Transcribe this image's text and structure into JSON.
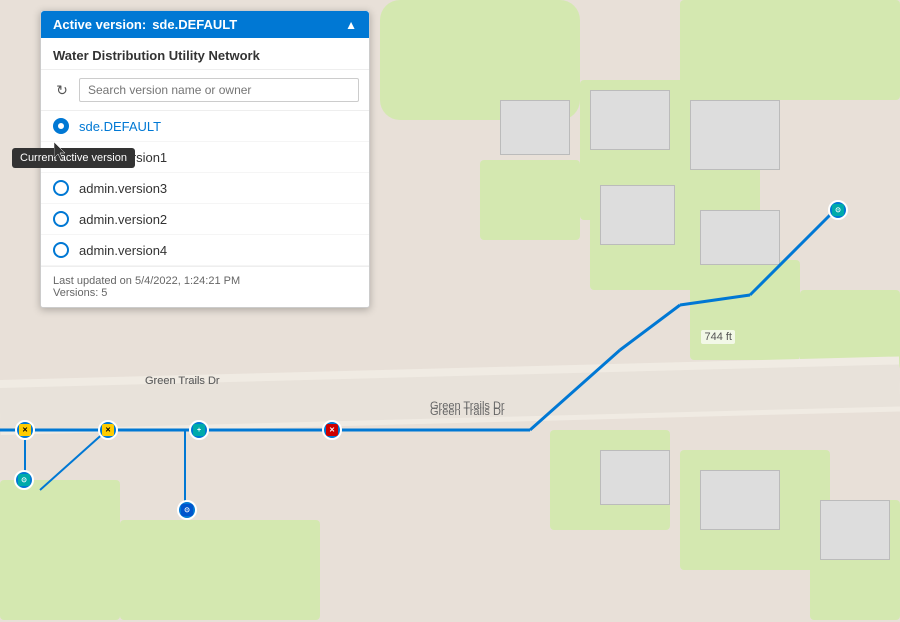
{
  "map": {
    "road_labels": [
      "Green Trails Dr",
      "Green Trails Dr"
    ],
    "elevation_label": "744 ft"
  },
  "active_version_bar": {
    "label": "Active version:",
    "version": "sde.DEFAULT",
    "chevron": "▲"
  },
  "panel": {
    "title": "Water Distribution Utility Network",
    "search_placeholder": "Search version name or owner",
    "refresh_icon": "↻",
    "versions": [
      {
        "name": "sde.DEFAULT",
        "active": true,
        "hovered": true
      },
      {
        "name": "admin.version1",
        "active": false,
        "hovered": false
      },
      {
        "name": "admin.version3",
        "active": false,
        "hovered": false
      },
      {
        "name": "admin.version2",
        "active": false,
        "hovered": false
      },
      {
        "name": "admin.version4",
        "active": false,
        "hovered": false
      }
    ],
    "footer": {
      "last_updated": "Last updated on 5/4/2022, 1:24:21 PM",
      "versions_count": "Versions: 5"
    }
  },
  "tooltip": {
    "text": "Current active version"
  }
}
